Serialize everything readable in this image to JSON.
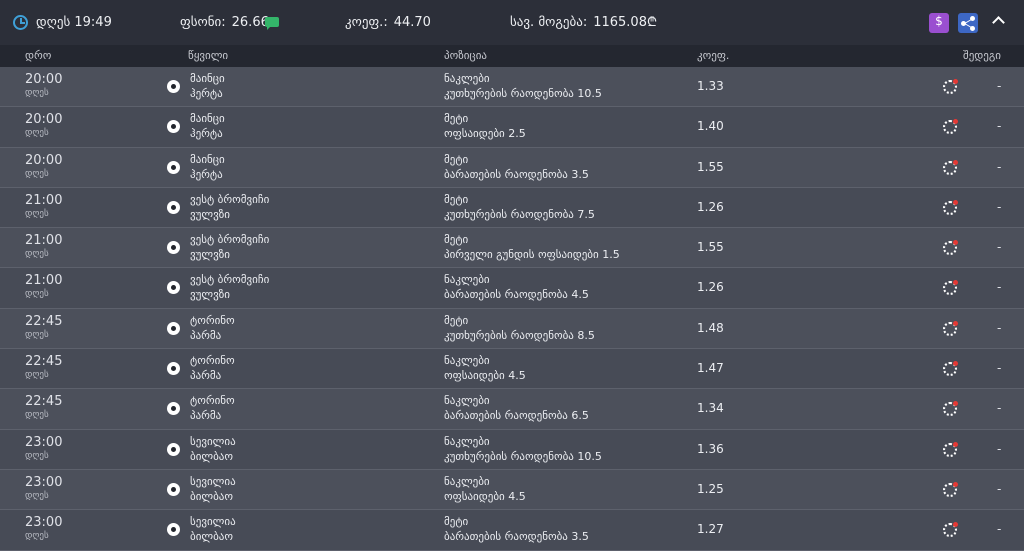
{
  "header": {
    "time_label": "დღეს 19:49",
    "bonus_label": "ფსონი:",
    "bonus_value": "26.66",
    "odds_label": "კოეფ.:",
    "odds_value": "44.70",
    "win_label": "სავ. მოგება:",
    "win_value": "1165.08₾",
    "pay_icon_text": "$"
  },
  "columns": {
    "time": "დრო",
    "event": "წყვილი",
    "position": "პოზიცია",
    "odds": "კოეფ.",
    "result": "შედეგი"
  },
  "rows": [
    {
      "time": "20:00",
      "day": "დღეს",
      "home": "მაინცი",
      "away": "ჰერტა",
      "selection": "ნაკლები",
      "market": "კუთხურების რაოდენობა 10.5",
      "odds": "1.33",
      "result": "-"
    },
    {
      "time": "20:00",
      "day": "დღეს",
      "home": "მაინცი",
      "away": "ჰერტა",
      "selection": "მეტი",
      "market": "ოფსაიდები 2.5",
      "odds": "1.40",
      "result": "-"
    },
    {
      "time": "20:00",
      "day": "დღეს",
      "home": "მაინცი",
      "away": "ჰერტა",
      "selection": "მეტი",
      "market": "ბარათების რაოდენობა 3.5",
      "odds": "1.55",
      "result": "-"
    },
    {
      "time": "21:00",
      "day": "დღეს",
      "home": "ვესტ ბრომვიჩი",
      "away": "ვულვზი",
      "selection": "მეტი",
      "market": "კუთხურების რაოდენობა 7.5",
      "odds": "1.26",
      "result": "-"
    },
    {
      "time": "21:00",
      "day": "დღეს",
      "home": "ვესტ ბრომვიჩი",
      "away": "ვულვზი",
      "selection": "მეტი",
      "market": "პირველი გუნდის ოფსაიდები 1.5",
      "odds": "1.55",
      "result": "-"
    },
    {
      "time": "21:00",
      "day": "დღეს",
      "home": "ვესტ ბრომვიჩი",
      "away": "ვულვზი",
      "selection": "ნაკლები",
      "market": "ბარათების რაოდენობა 4.5",
      "odds": "1.26",
      "result": "-"
    },
    {
      "time": "22:45",
      "day": "დღეს",
      "home": "ტორინო",
      "away": "პარმა",
      "selection": "მეტი",
      "market": "კუთხურების რაოდენობა 8.5",
      "odds": "1.48",
      "result": "-"
    },
    {
      "time": "22:45",
      "day": "დღეს",
      "home": "ტორინო",
      "away": "პარმა",
      "selection": "ნაკლები",
      "market": "ოფსაიდები 4.5",
      "odds": "1.47",
      "result": "-"
    },
    {
      "time": "22:45",
      "day": "დღეს",
      "home": "ტორინო",
      "away": "პარმა",
      "selection": "ნაკლები",
      "market": "ბარათების რაოდენობა 6.5",
      "odds": "1.34",
      "result": "-"
    },
    {
      "time": "23:00",
      "day": "დღეს",
      "home": "სევილია",
      "away": "ბილბაო",
      "selection": "ნაკლები",
      "market": "კუთხურების რაოდენობა 10.5",
      "odds": "1.36",
      "result": "-"
    },
    {
      "time": "23:00",
      "day": "დღეს",
      "home": "სევილია",
      "away": "ბილბაო",
      "selection": "ნაკლები",
      "market": "ოფსაიდები 4.5",
      "odds": "1.25",
      "result": "-"
    },
    {
      "time": "23:00",
      "day": "დღეს",
      "home": "სევილია",
      "away": "ბილბაო",
      "selection": "მეტი",
      "market": "ბარათების რაოდენობა 3.5",
      "odds": "1.27",
      "result": "-"
    }
  ]
}
